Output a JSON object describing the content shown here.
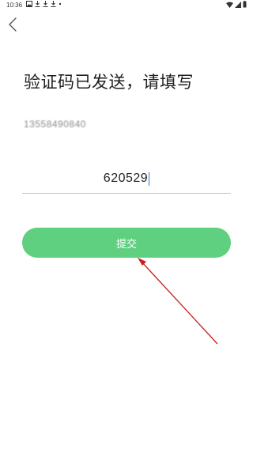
{
  "status_bar": {
    "time": "10:36",
    "left_icons": [
      "gallery-icon",
      "download-icon",
      "download-icon",
      "download-icon",
      "dot-icon"
    ],
    "right_icons": [
      "wifi-icon",
      "signal-icon",
      "battery-icon"
    ]
  },
  "nav": {
    "back_icon": "chevron-left-icon"
  },
  "page": {
    "title": "验证码已发送，请填写",
    "phone_number": "13558490840"
  },
  "code_input": {
    "value": "620529"
  },
  "submit_button": {
    "label": "提交",
    "color": "#5fcf80"
  },
  "annotation": {
    "arrow_color": "#c81e1e"
  }
}
